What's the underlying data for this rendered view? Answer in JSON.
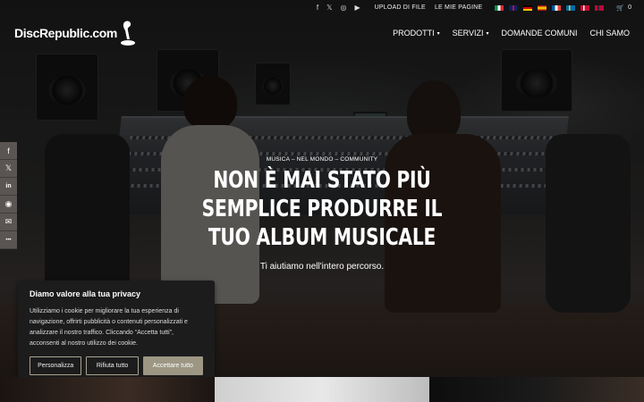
{
  "topbar": {
    "social": [
      {
        "icon": "facebook-icon",
        "glyph": "f"
      },
      {
        "icon": "x-icon",
        "glyph": "𝕏"
      },
      {
        "icon": "instagram-icon",
        "glyph": "◎"
      },
      {
        "icon": "youtube-icon",
        "glyph": "▶"
      }
    ],
    "upload_label": "UPLOAD DI FILE",
    "pages_label": "LE MIE PAGINE",
    "flags": [
      {
        "name": "flag-italy",
        "colors": [
          "#009246",
          "#ffffff",
          "#ce2b37"
        ]
      },
      {
        "name": "flag-uk",
        "colors": [
          "#012169",
          "#c8102e",
          "#ffffff"
        ]
      },
      {
        "name": "flag-germany",
        "colors": [
          "#000000",
          "#dd0000",
          "#ffce00"
        ]
      },
      {
        "name": "flag-spain",
        "colors": [
          "#aa151b",
          "#f1bf00",
          "#aa151b"
        ]
      },
      {
        "name": "flag-france",
        "colors": [
          "#0055a4",
          "#ffffff",
          "#ef4135"
        ]
      },
      {
        "name": "flag-sweden",
        "colors": [
          "#006aa7",
          "#fecc00",
          "#006aa7"
        ]
      },
      {
        "name": "flag-denmark",
        "colors": [
          "#c60c30",
          "#ffffff",
          "#c60c30"
        ]
      },
      {
        "name": "flag-norway",
        "colors": [
          "#ba0c2f",
          "#00205b",
          "#ffffff"
        ]
      }
    ],
    "cart_count": "0"
  },
  "header": {
    "logo_text": "DiscRepublic.com",
    "nav": [
      {
        "label": "PRODOTTI",
        "dropdown": true
      },
      {
        "label": "SERVIZI",
        "dropdown": true
      },
      {
        "label": "DOMANDE COMUNI",
        "dropdown": false
      },
      {
        "label": "CHI SAMO",
        "dropdown": false
      }
    ]
  },
  "hero": {
    "breadcrumbs": "MUSICA – NEL MONDO – COMMUNITY",
    "headline": "NON È MAI STATO PIÙ SEMPLICE PRODURRE IL TUO ALBUM MUSICALE",
    "subtitle": "Ti aiutiamo nell'intero percorso."
  },
  "share": [
    {
      "icon": "facebook-icon",
      "glyph": "f"
    },
    {
      "icon": "x-icon",
      "glyph": "𝕏"
    },
    {
      "icon": "linkedin-icon",
      "glyph": "in"
    },
    {
      "icon": "reddit-icon",
      "glyph": "◉"
    },
    {
      "icon": "email-icon",
      "glyph": "✉"
    },
    {
      "icon": "more-icon",
      "glyph": "•••"
    }
  ],
  "privacy": {
    "title": "Diamo valore alla tua privacy",
    "text": "Utilizziamo i cookie per migliorare la tua esperienza di navigazione, offrirti pubblicità o contenuti personalizzati e analizzare il nostro traffico. Cliccando “Accetta tutti”, acconsenti al nostro utilizzo dei cookie.",
    "btn_customize": "Personalizza",
    "btn_reject": "Rifiuta tutto",
    "btn_accept": "Accettare tutto"
  },
  "colors": {
    "accent": "#9c9683",
    "share_bg": "#5a5552",
    "privacy_bg": "#1c1c1c"
  }
}
